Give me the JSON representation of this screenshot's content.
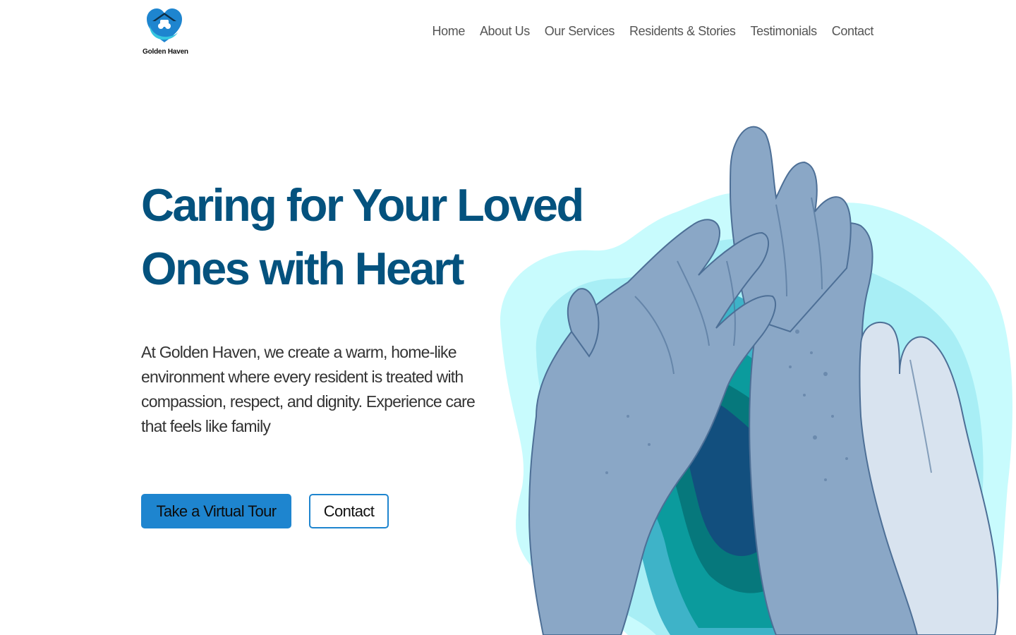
{
  "brand": {
    "name": "Golden Haven",
    "colors": {
      "primary": "#04527e",
      "accent": "#1e85cf",
      "aqua": "#c8fbfd",
      "teal": "#0b9b9d"
    }
  },
  "nav": {
    "items": [
      {
        "label": "Home"
      },
      {
        "label": "About Us"
      },
      {
        "label": "Our Services"
      },
      {
        "label": "Residents & Stories"
      },
      {
        "label": "Testimonials"
      },
      {
        "label": "Contact"
      }
    ]
  },
  "hero": {
    "title": "Caring for Your Loved Ones with Heart",
    "description": "At Golden Haven, we create a warm, home-like environment where every resident is treated with compassion, respect, and dignity. Experience care that feels like family",
    "primary_button": "Take a Virtual Tour",
    "secondary_button": "Contact",
    "image": {
      "icon": "joined-hands-illustration"
    }
  }
}
